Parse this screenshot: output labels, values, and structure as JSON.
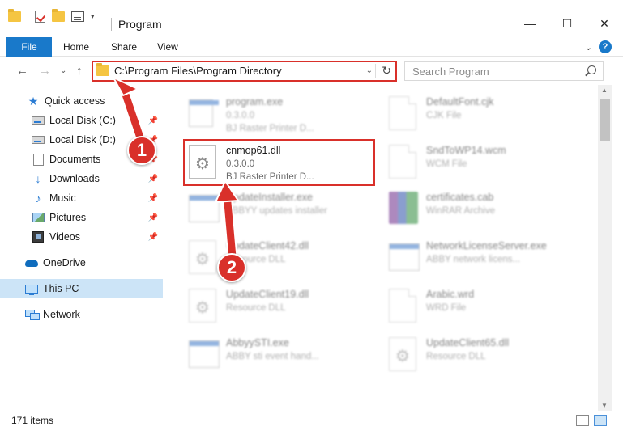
{
  "window": {
    "title": "Program",
    "minimize": "—",
    "maximize": "☐",
    "close": "✕"
  },
  "ribbon": {
    "file": "File",
    "home": "Home",
    "share": "Share",
    "view": "View",
    "expand": "⌄",
    "help": "?"
  },
  "nav": {
    "back": "←",
    "forward": "→",
    "recent": "⌄",
    "up": "↑",
    "address": "C:\\Program Files\\Program Directory",
    "address_dropdown": "⌄",
    "refresh": "↻",
    "search_placeholder": "Search Program"
  },
  "sidebar": {
    "items": [
      {
        "label": "Quick access",
        "pinned": false
      },
      {
        "label": "Local Disk (C:)",
        "pinned": true
      },
      {
        "label": "Local Disk (D:)",
        "pinned": true
      },
      {
        "label": "Documents",
        "pinned": true
      },
      {
        "label": "Downloads",
        "pinned": true
      },
      {
        "label": "Music",
        "pinned": true
      },
      {
        "label": "Pictures",
        "pinned": true
      },
      {
        "label": "Videos",
        "pinned": true
      },
      {
        "label": "OneDrive",
        "pinned": false
      },
      {
        "label": "This PC",
        "pinned": false,
        "selected": true
      },
      {
        "label": "Network",
        "pinned": false
      }
    ],
    "pin_glyph": "📌"
  },
  "files": {
    "left": [
      {
        "name": "program.exe",
        "line1": "0.3.0.0",
        "line2": "BJ Raster Printer D..."
      },
      {
        "name": "cnmop61.dll",
        "line1": "0.3.0.0",
        "line2": "BJ Raster Printer D..."
      },
      {
        "name": "UpdateInstaller.exe",
        "line1": "ABBYY updates installer",
        "line2": ""
      },
      {
        "name": "UpdateClient42.dll",
        "line1": "Resource DLL",
        "line2": ""
      },
      {
        "name": "UpdateClient19.dll",
        "line1": "Resource DLL",
        "line2": ""
      },
      {
        "name": "AbbyySTI.exe",
        "line1": "ABBY sti event hand...",
        "line2": ""
      }
    ],
    "right": [
      {
        "name": "DefaultFont.cjk",
        "line1": "CJK File",
        "line2": ""
      },
      {
        "name": "SndToWP14.wcm",
        "line1": "WCM File",
        "line2": ""
      },
      {
        "name": "certificates.cab",
        "line1": "WinRAR Archive",
        "line2": ""
      },
      {
        "name": "NetworkLicenseServer.exe",
        "line1": "ABBY network licens...",
        "line2": ""
      },
      {
        "name": "Arabic.wrd",
        "line1": "WRD File",
        "line2": ""
      },
      {
        "name": "UpdateClient65.dll",
        "line1": "Resource DLL",
        "line2": ""
      }
    ]
  },
  "annotations": {
    "step1": "1",
    "step2": "2"
  },
  "status": {
    "count": "171 items"
  },
  "colors": {
    "accent": "#1979ca",
    "highlight": "#d9302a",
    "selected": "#cce4f7"
  }
}
